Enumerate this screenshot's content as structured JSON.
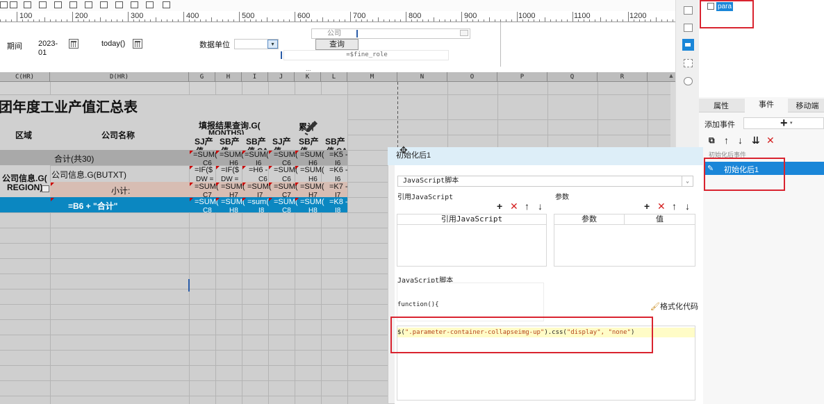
{
  "ruler": {
    "labels": [
      "100",
      "200",
      "300",
      "400",
      "500",
      "600",
      "700",
      "800",
      "900",
      "1000",
      "1100",
      "1200"
    ]
  },
  "params": {
    "period_label": "期间",
    "period_value": "2023-01",
    "today_value": "today()",
    "unit_label": "数据单位",
    "company_label": "公司",
    "query_button": "查询",
    "fine_role": "=$fine_role",
    "sep_dots": "..."
  },
  "sheet": {
    "columns": [
      "C(HR)",
      "D(HR)",
      "G",
      "H",
      "I",
      "J",
      "K",
      "L",
      "M",
      "N",
      "O",
      "P",
      "Q",
      "R"
    ],
    "title": "集团年度工业产值汇总表",
    "region_header": "区域",
    "company_header": "公司名称",
    "report_query_header": "填报结果查询.G(",
    "months_header": "MONTHS)",
    "accum_header": "累计",
    "sub_headers": [
      "SJ产",
      "SB产",
      "SB产",
      "SJ产",
      "SB产",
      "SB产"
    ],
    "sub_headers2": [
      "值",
      "值",
      "值 CA",
      "值",
      "值",
      "值 CA"
    ],
    "total_row": "合计(共30)",
    "total_cells": [
      "=SUM(",
      "=SUM(",
      "=SUM(",
      "=SUM(",
      "=SUM(",
      "=K5 -"
    ],
    "total_cells2": [
      "C6",
      "H6",
      "I6",
      "C6",
      "H6",
      "I6"
    ],
    "region_value": "公司信息.G(",
    "region_value2": "REGION)",
    "company_value": "公司信息.G(BUTXT)",
    "row6_cells": [
      "=IF($",
      "=IF($",
      "=H6 -",
      "=SUM(",
      "=SUM(",
      "=K6 -"
    ],
    "row6_cells2": [
      "DW =",
      "DW =",
      "C6",
      "C6",
      "H6",
      "I6"
    ],
    "subtotal_label": "小计:",
    "row7_cells": [
      "=SUM(",
      "=SUM(",
      "=SUM(",
      "=SUM(",
      "=SUM(",
      "=K7 -"
    ],
    "row7_cells2": [
      "C7",
      "H7",
      "I7",
      "C7",
      "H7",
      "I7"
    ],
    "grand_total_formula": "=B6 + \"合计\"",
    "row8_cells": [
      "=SUM(",
      "=SUM(",
      "=sum(",
      "=SUM(",
      "=SUM(",
      "=K8 -"
    ],
    "row8_cells2": [
      "C8",
      "H8",
      "I8",
      "C8",
      "H8",
      "I8"
    ]
  },
  "right_panel": {
    "widget_name": "para",
    "tabs": [
      "属性",
      "事件",
      "移动端"
    ],
    "add_event_label": "添加事件",
    "add_symbol": "+",
    "event_group_label": "初始化后事件",
    "event_item": "初始化后1"
  },
  "dialog": {
    "title": "初始化后1",
    "script_type": "JavaScript脚本",
    "ref_js_section": "引用JavaScript",
    "params_section": "参数",
    "ref_js_col": "引用JavaScript",
    "param_col": "参数",
    "value_col": "值",
    "script_section": "JavaScript脚本",
    "function_header": "function(){",
    "format_code": "格式化代码",
    "code_selector": "\".parameter-container-collapseimg-up\"",
    "code_args": "\"display\", \"none\"",
    "code_prefix": "$(",
    "code_mid": ").css(",
    "code_suffix": ")"
  },
  "colors": {
    "highlight": "#d9232f",
    "total_row_bg": "#a9a9a9",
    "subtotal_bg": "#d7bdb3",
    "grand_total_bg": "#0b87c1",
    "selected_event_bg": "#1a86d8",
    "code_string": "#b5451b"
  }
}
